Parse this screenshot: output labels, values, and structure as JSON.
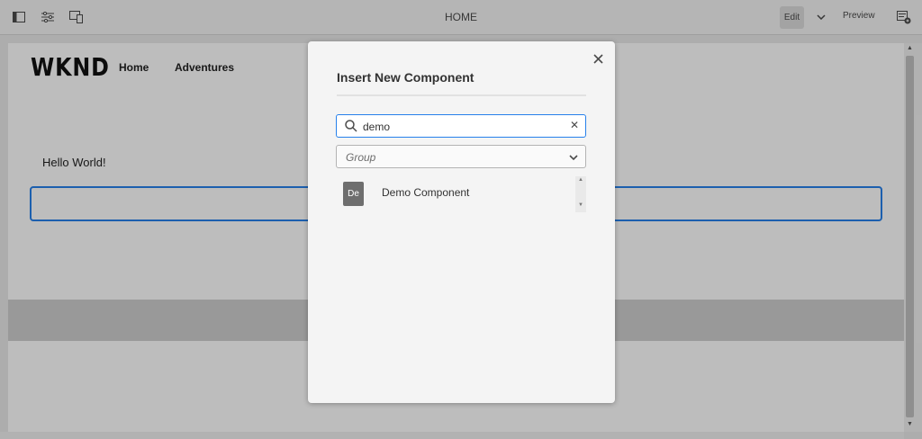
{
  "toolbar": {
    "title": "HOME",
    "edit_label": "Edit",
    "preview_label": "Preview",
    "icons": [
      "side-panel-icon",
      "properties-icon",
      "emulator-icon",
      "chevron-down-icon",
      "page-info-icon"
    ]
  },
  "site": {
    "logo": "WKND",
    "nav": [
      "Home",
      "Adventures"
    ],
    "hello_text": "Hello World!"
  },
  "dialog": {
    "title": "Insert New Component",
    "search_value": "demo",
    "group_placeholder": "Group",
    "results": [
      {
        "badge": "De",
        "label": "Demo Component"
      }
    ]
  },
  "colors": {
    "accent": "#2680eb",
    "badge": "#6e6e6e"
  }
}
